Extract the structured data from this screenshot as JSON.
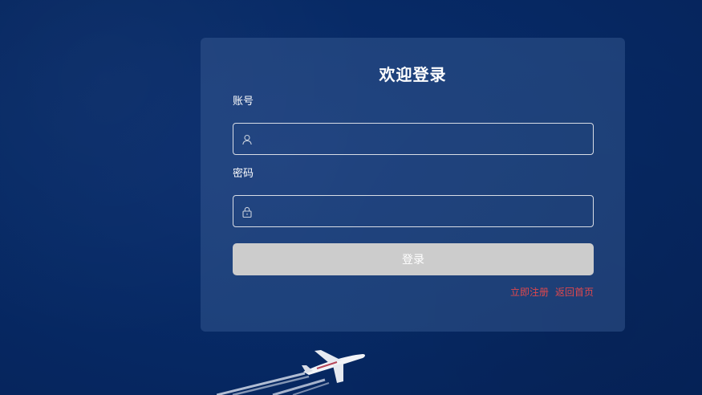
{
  "login": {
    "title": "欢迎登录",
    "account_label": "账号",
    "account_value": "",
    "account_placeholder": "",
    "account_icon": "user-icon",
    "password_label": "密码",
    "password_value": "",
    "password_placeholder": "",
    "password_icon": "lock-icon",
    "submit_label": "登录",
    "register_link": "立即注册",
    "home_link": "返回首页"
  },
  "colors": {
    "background": "#072a66",
    "panel": "rgba(60,95,150,0.45)",
    "button": "#cccccc",
    "link": "#e0484d"
  }
}
